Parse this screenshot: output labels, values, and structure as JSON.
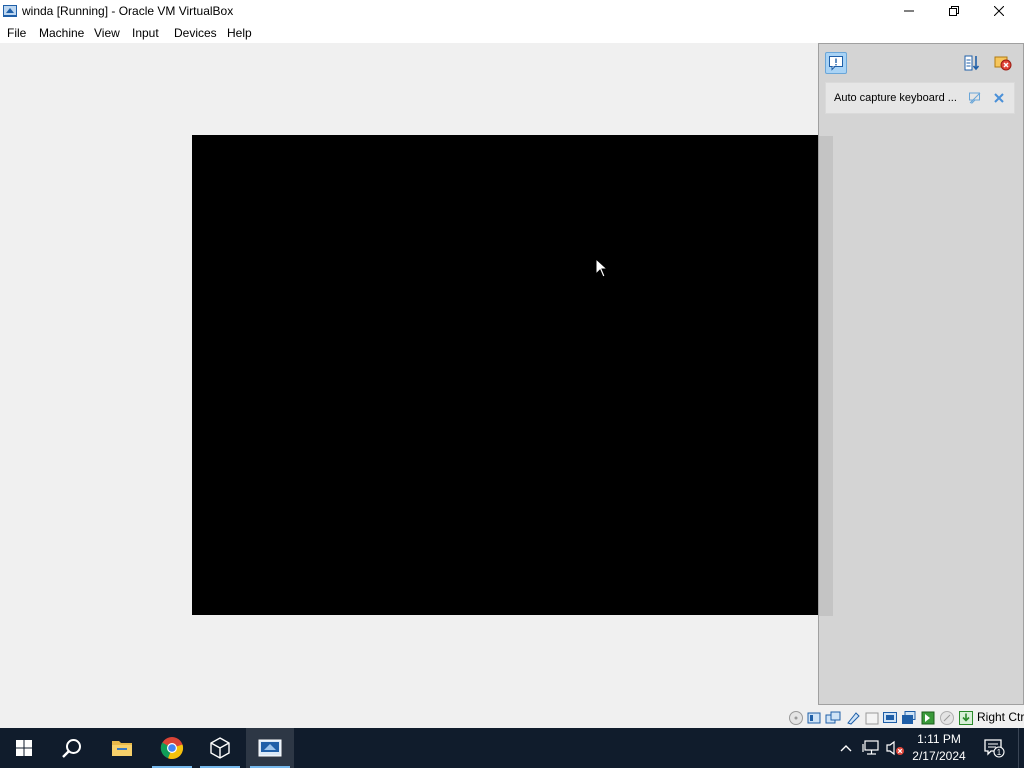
{
  "window": {
    "title": "winda [Running] - Oracle VM VirtualBox",
    "icon": "virtualbox-icon"
  },
  "menu": {
    "items": [
      "File",
      "Machine",
      "View",
      "Input",
      "Devices",
      "Help"
    ]
  },
  "notifications": {
    "items": [
      {
        "text": "Auto capture keyboard ..."
      }
    ]
  },
  "statusbar": {
    "icons": [
      "hard-disk-icon",
      "optical-drive-icon",
      "audio-icon",
      "network-icon",
      "usb-icon",
      "shared-folders-icon",
      "display-icon",
      "recording-icon",
      "cpu-icon",
      "mouse-integration-icon",
      "keyboard-icon"
    ],
    "host_key": "Right Ctrl"
  },
  "taskbar": {
    "apps": [
      "start-icon",
      "search-icon",
      "file-explorer-icon",
      "chrome-icon",
      "virtualbox-manager-icon",
      "virtualbox-vm-icon"
    ],
    "time": "1:11 PM",
    "date": "2/17/2024",
    "notification_count": "1"
  },
  "colors": {
    "taskbar_bg": "#101c2c",
    "vm_screen": "#000000",
    "panel_bg": "#d4d4d4",
    "accent": "#76b9ed"
  }
}
